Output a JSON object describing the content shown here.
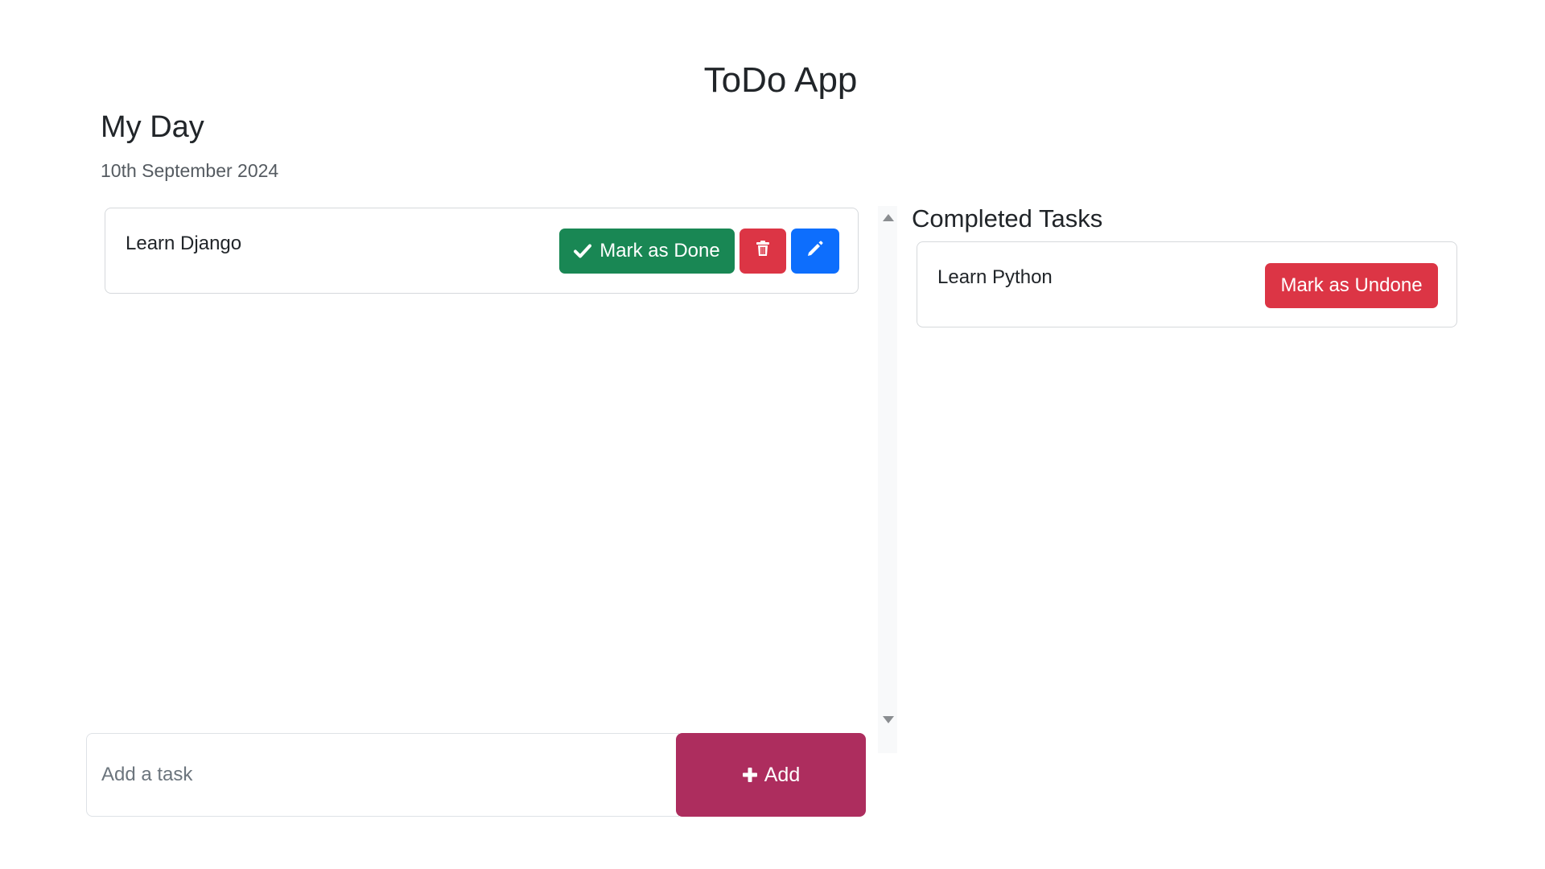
{
  "app": {
    "title": "ToDo App"
  },
  "my_day": {
    "title": "My Day",
    "date": "10th September 2024",
    "tasks": [
      {
        "text": "Learn Django",
        "done_label": "Mark as Done"
      }
    ]
  },
  "add_form": {
    "placeholder": "Add a task",
    "add_label": "Add"
  },
  "completed": {
    "title": "Completed Tasks",
    "tasks": [
      {
        "text": "Learn Python",
        "undone_label": "Mark as Undone"
      }
    ]
  },
  "icons": {
    "done": "check-icon",
    "delete": "trash-icon",
    "edit": "pencil-icon",
    "add": "plus-icon",
    "scroll_up": "scroll-up-arrow-icon",
    "scroll_down": "scroll-down-arrow-icon"
  },
  "colors": {
    "done_button": "#198754",
    "delete_button": "#dc3545",
    "edit_button": "#0d6efd",
    "add_button": "#ad2d5e",
    "undone_button": "#dc3545"
  }
}
